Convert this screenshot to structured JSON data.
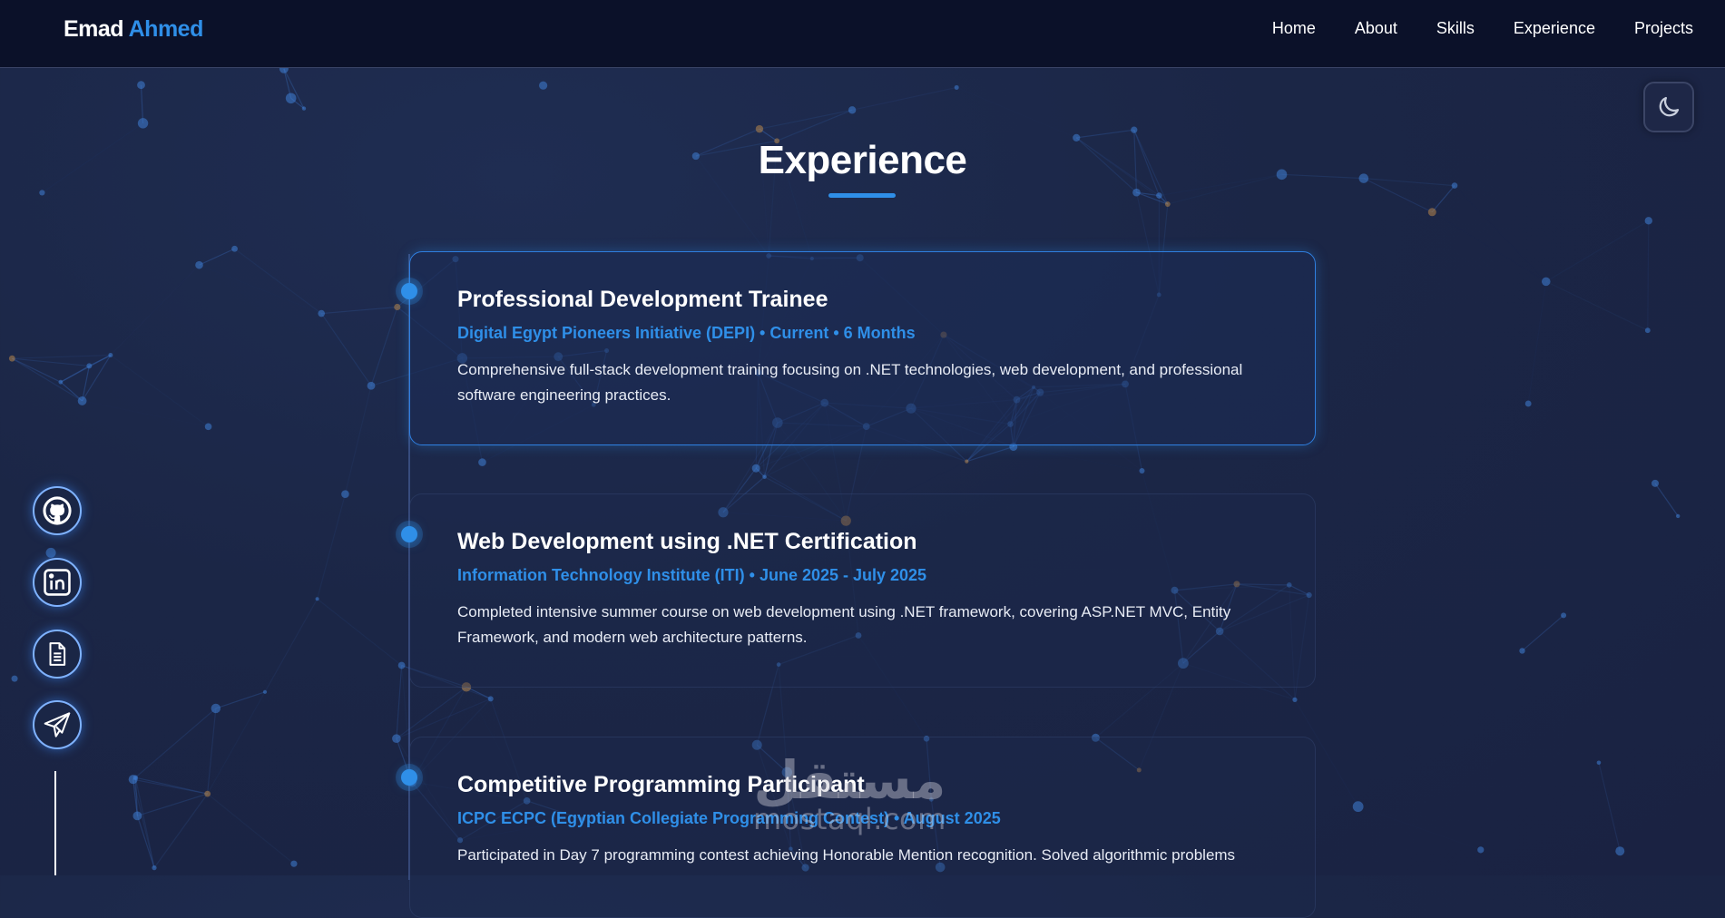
{
  "brand": {
    "first": "Emad",
    "last": "Ahmed"
  },
  "nav": {
    "items": [
      "Home",
      "About",
      "Skills",
      "Experience",
      "Projects"
    ]
  },
  "theme_toggle": {
    "icon": "moon-icon"
  },
  "section": {
    "title": "Experience"
  },
  "experience": [
    {
      "title": "Professional Development Trainee",
      "meta": "Digital Egypt Pioneers Initiative (DEPI) • Current • 6 Months",
      "description": "Comprehensive full-stack development training focusing on .NET technologies, web development, and professional software engineering practices."
    },
    {
      "title": "Web Development using .NET Certification",
      "meta": "Information Technology Institute (ITI) • June 2025 - July 2025",
      "description": "Completed intensive summer course on web development using .NET framework, covering ASP.NET MVC, Entity Framework, and modern web architecture patterns."
    },
    {
      "title": "Competitive Programming Participant",
      "meta": "ICPC ECPC (Egyptian Collegiate Programming Contest) • August 2025",
      "description": "Participated in Day 7 programming contest achieving Honorable Mention recognition. Solved algorithmic problems"
    }
  ],
  "social": [
    "github-icon",
    "linkedin-icon",
    "document-icon",
    "paper-plane-icon"
  ],
  "watermark": {
    "arabic": "مستقل",
    "latin": "mostaql.com"
  },
  "colors": {
    "accent": "#2f8fe8",
    "navbar": "#0b1129",
    "background": "#1b2646"
  }
}
